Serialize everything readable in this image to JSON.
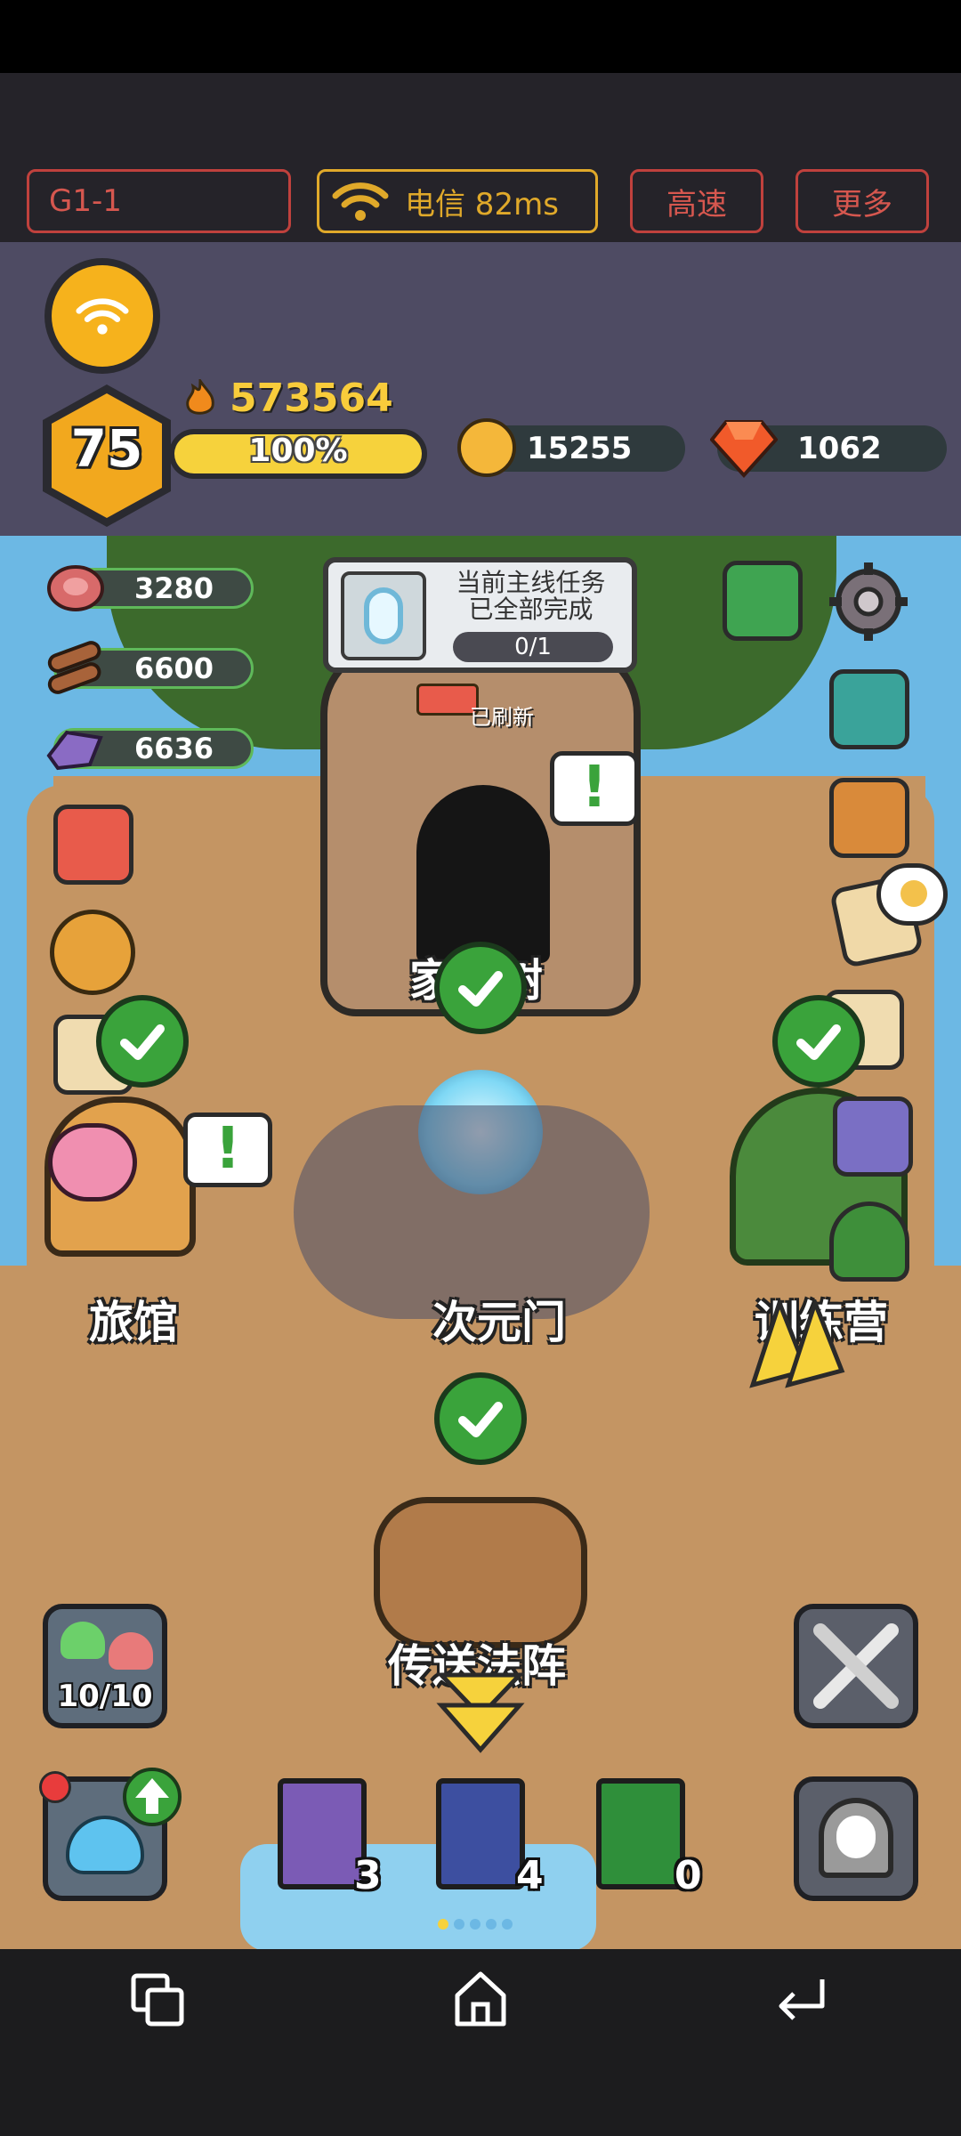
{
  "toolbar": {
    "room_label": "G1-1",
    "network_label": "电信 82ms",
    "speed_label": "高速",
    "more_label": "更多"
  },
  "player": {
    "level": "75",
    "power": "573564",
    "exp_percent_label": "100%",
    "exp_fraction": 1.0,
    "gold": "15255",
    "gems": "1062"
  },
  "resources": {
    "meat": "3280",
    "wood": "6600",
    "ore": "6636"
  },
  "quest": {
    "title_line1": "当前主线任务",
    "title_line2": "已全部完成",
    "progress": "0/1"
  },
  "tree": {
    "refreshed_label": "已刷新",
    "name": "家园树"
  },
  "buildings": {
    "inn": "旅馆",
    "portal": "次元门",
    "camp": "训练营",
    "teleport": "传送法阵"
  },
  "team": {
    "capacity": "10/10"
  },
  "books": [
    {
      "count": "3",
      "color": "#7b5bb5"
    },
    {
      "count": "4",
      "color": "#3d4fa0"
    },
    {
      "count": "0",
      "color": "#2f8f3a"
    }
  ],
  "colors": {
    "accent_red": "#c0413d",
    "gold_border": "#e0a92a",
    "exp_bar": "#f6d23c",
    "check_green": "#3aa33b"
  },
  "icons": {
    "home": "home-icon",
    "back": "back-icon",
    "recents": "recents-icon"
  }
}
